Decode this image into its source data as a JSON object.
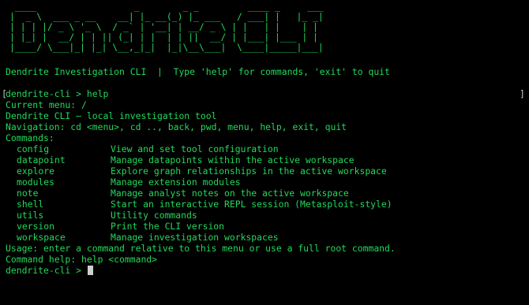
{
  "terminal": {
    "banner_lines": [
      " ____                  _        _ _         ____ _     ___",
      "|  _ \\  ___ _ __    __| |_ __(_) |_ ___   / ___| |   |_ _|",
      "| | | |/ _ \\ '_ \\  / _` | '__| | __/ _ \\ | |   | |    | |",
      "| |_| |  __/ | | || (_| | |  | | ||  __/ | |___| |___ | |",
      "|____/ \\___|_| |_| \\__,_|_|  |_|\\__\\___|  \\____|_____|___|"
    ],
    "welcome": "Dendrite Investigation CLI  |  Type 'help' for commands, 'exit' to quit",
    "bracket_left": "[",
    "bracket_right": "]",
    "prompt_with_command": "dendrite-cli > help",
    "current_menu": "Current menu: /",
    "description": "Dendrite CLI — local investigation tool",
    "navigation": "Navigation: cd <menu>, cd .., back, pwd, menu, help, exit, quit",
    "commands_header": "Commands:",
    "commands": [
      {
        "name": "config",
        "desc": "View and set tool configuration"
      },
      {
        "name": "datapoint",
        "desc": "Manage datapoints within the active workspace"
      },
      {
        "name": "explore",
        "desc": "Explore graph relationships in the active workspace"
      },
      {
        "name": "modules",
        "desc": "Manage extension modules"
      },
      {
        "name": "note",
        "desc": "Manage analyst notes on the active workspace"
      },
      {
        "name": "shell",
        "desc": "Start an interactive REPL session (Metasploit-style)"
      },
      {
        "name": "utils",
        "desc": "Utility commands"
      },
      {
        "name": "version",
        "desc": "Print the CLI version"
      },
      {
        "name": "workspace",
        "desc": "Manage investigation workspaces"
      }
    ],
    "usage": "Usage: enter a command relative to this menu or use a full root command.",
    "command_help": "Command help: help <command>",
    "prompt": "dendrite-cli > "
  },
  "colors": {
    "background": "#000000",
    "text": "#22d95a",
    "cursor": "#cfcfcf",
    "bracket": "#c9c9c9"
  }
}
